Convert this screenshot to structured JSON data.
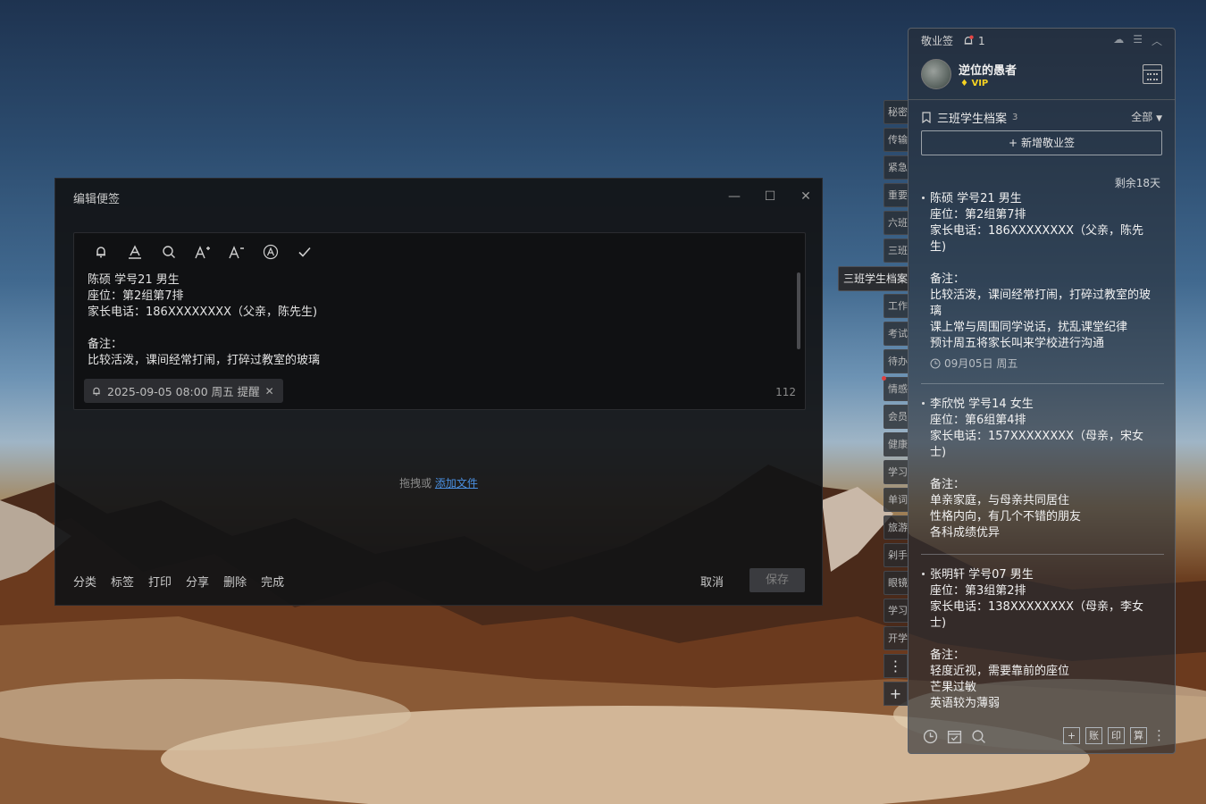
{
  "edit_window": {
    "title": "编辑便签",
    "toolbar_icons": [
      "bell-icon",
      "font-color-icon",
      "search-icon",
      "font-larger-icon",
      "font-smaller-icon",
      "clear-format-icon",
      "check-icon"
    ],
    "content_lines": [
      "陈硕 学号21 男生",
      "座位：第2组第7排",
      "家长电话：186XXXXXXXX（父亲，陈先生)",
      "",
      "备注：",
      "比较活泼，课间经常打闹，打碎过教室的玻璃"
    ],
    "reminder": "2025-09-05 08:00 周五 提醒",
    "char_count": "112",
    "drop_text": "拖拽或",
    "add_file_link": "添加文件",
    "actions": [
      "分类",
      "标签",
      "打印",
      "分享",
      "删除",
      "完成"
    ],
    "cancel": "取消",
    "save": "保存"
  },
  "side_tabs": [
    "秘密",
    "传输",
    "紧急",
    "重要",
    "六班",
    "三班"
  ],
  "side_tabs_lower": [
    "工作",
    "考试",
    "待办",
    "情感",
    "会员",
    "健康",
    "学习",
    "单词",
    "旅游",
    "剁手",
    "眼镜",
    "学习",
    "开学"
  ],
  "side_active": "三班学生档案",
  "panel": {
    "app_name": "敬业签",
    "notification_count": "1",
    "username": "逆位的愚者",
    "vip": "VIP",
    "category": "三班学生档案",
    "category_count": "3",
    "filter": "全部",
    "new_button": "新增敬业签",
    "remaining": "剩余18天",
    "notes": [
      {
        "lines": [
          "陈硕 学号21 男生",
          "座位：第2组第7排",
          "家长电话：186XXXXXXXX（父亲，陈先",
          "生)",
          "",
          "备注：",
          "比较活泼，课间经常打闹，打碎过教室的玻",
          "璃",
          "课上常与周围同学说话，扰乱课堂纪律",
          "预计周五将家长叫来学校进行沟通"
        ],
        "date": "09月05日 周五"
      },
      {
        "lines": [
          "李欣悦 学号14 女生",
          "座位：第6组第4排",
          "家长电话：157XXXXXXXX（母亲，宋女",
          "士)",
          "",
          "备注：",
          "单亲家庭，与母亲共同居住",
          "性格内向，有几个不错的朋友",
          "各科成绩优异"
        ],
        "date": ""
      },
      {
        "lines": [
          "张明轩 学号07 男生",
          "座位：第3组第2排",
          "家长电话：138XXXXXXXX（母亲，李女",
          "士)",
          "",
          "备注：",
          "轻度近视，需要靠前的座位",
          "芒果过敏",
          "英语较为薄弱"
        ],
        "date": ""
      }
    ],
    "bottom_right": [
      "+",
      "账",
      "印",
      "算"
    ]
  }
}
